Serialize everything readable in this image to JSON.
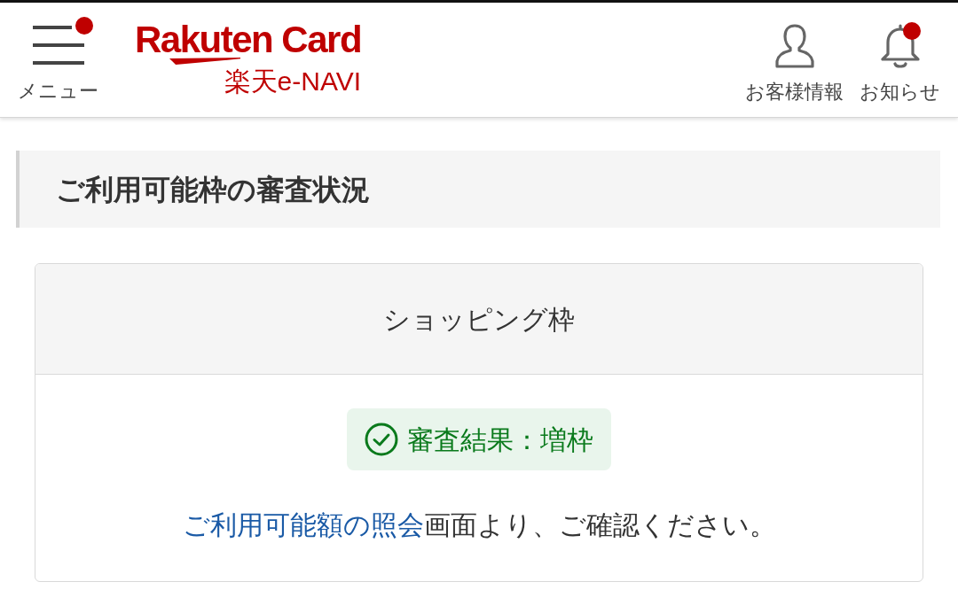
{
  "header": {
    "menu": {
      "label": "メニュー",
      "notification": true
    },
    "logo": {
      "brand": "Rakuten Card",
      "service": "楽天e-NAVI"
    },
    "actions": [
      {
        "kind": "user",
        "label": "お客様情報",
        "notification": false
      },
      {
        "kind": "bell",
        "label": "お知らせ",
        "notification": true
      }
    ]
  },
  "section": {
    "title": "ご利用可能枠の審査状況"
  },
  "card": {
    "title": "ショッピング枠",
    "status": {
      "kind": "success",
      "text": "審査結果：増枠"
    },
    "message": {
      "link": "ご利用可能額の照会",
      "text": "画面より、ご確認ください。"
    }
  }
}
